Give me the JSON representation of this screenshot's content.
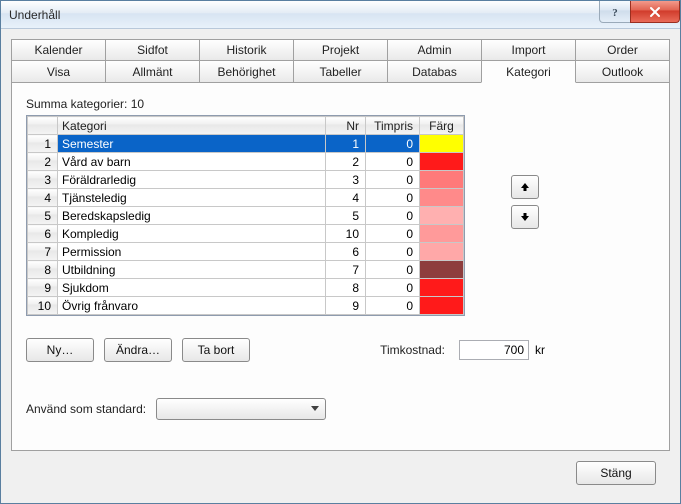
{
  "window": {
    "title": "Underhåll"
  },
  "tabs_top": [
    "Kalender",
    "Sidfot",
    "Historik",
    "Projekt",
    "Admin",
    "Import",
    "Order"
  ],
  "tabs_bottom": [
    "Visa",
    "Allmänt",
    "Behörighet",
    "Tabeller",
    "Databas",
    "Kategori",
    "Outlook"
  ],
  "active_tab": "Kategori",
  "summary_label": "Summa kategorier: 10",
  "columns": {
    "kat": "Kategori",
    "nr": "Nr",
    "tim": "Timpris",
    "farg": "Färg"
  },
  "rows": [
    {
      "n": 1,
      "kat": "Semester",
      "nr": 1,
      "tim": 0,
      "color": "#ffff00",
      "selected": true
    },
    {
      "n": 2,
      "kat": "Vård av barn",
      "nr": 2,
      "tim": 0,
      "color": "#ff1a1a"
    },
    {
      "n": 3,
      "kat": "Föräldrarledig",
      "nr": 3,
      "tim": 0,
      "color": "#ff7a7a"
    },
    {
      "n": 4,
      "kat": "Tjänsteledig",
      "nr": 4,
      "tim": 0,
      "color": "#ff8a8a"
    },
    {
      "n": 5,
      "kat": "Beredskapsledig",
      "nr": 5,
      "tim": 0,
      "color": "#ffb0b0"
    },
    {
      "n": 6,
      "kat": "Kompledig",
      "nr": 10,
      "tim": 0,
      "color": "#ff9a9a"
    },
    {
      "n": 7,
      "kat": "Permission",
      "nr": 6,
      "tim": 0,
      "color": "#ffa8a8"
    },
    {
      "n": 8,
      "kat": "Utbildning",
      "nr": 7,
      "tim": 0,
      "color": "#8e3d3d"
    },
    {
      "n": 9,
      "kat": "Sjukdom",
      "nr": 8,
      "tim": 0,
      "color": "#ff1a1a"
    },
    {
      "n": 10,
      "kat": "Övrig frånvaro",
      "nr": 9,
      "tim": 0,
      "color": "#ff1a1a"
    }
  ],
  "buttons": {
    "ny": "Ny…",
    "andra": "Ändra…",
    "ta_bort": "Ta bort",
    "stang": "Stäng"
  },
  "timkostnad": {
    "label": "Timkostnad:",
    "value": "700",
    "unit": "kr"
  },
  "default": {
    "label": "Använd som standard:",
    "value": ""
  }
}
